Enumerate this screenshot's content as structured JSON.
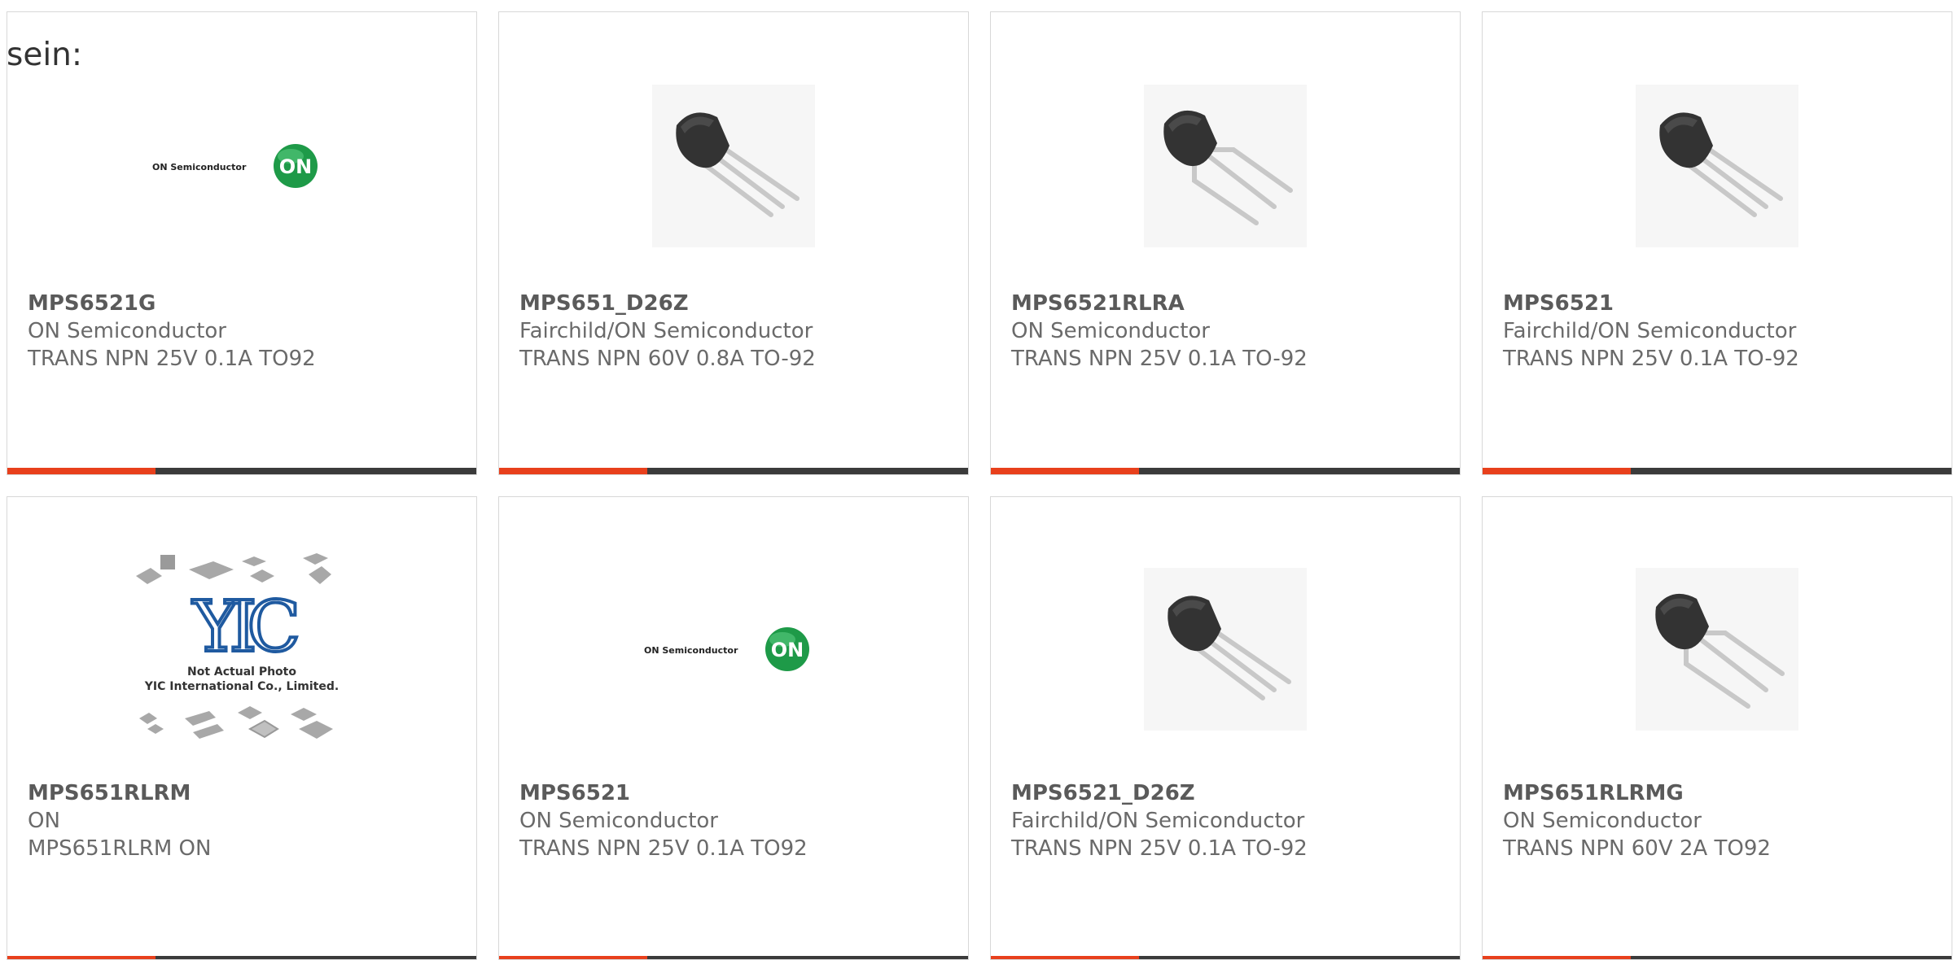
{
  "intro_text": "sein:",
  "colors": {
    "accent": "#e8401c",
    "bar": "#3b3b3b",
    "on_logo_green": "#1e9a48"
  },
  "products": [
    {
      "part": "MPS6521G",
      "maker": "ON Semiconductor",
      "desc": "TRANS NPN 25V 0.1A TO92",
      "image": "on-semiconductor-logo",
      "logo_text": "ON Semiconductor",
      "logo_badge": "ON"
    },
    {
      "part": "MPS651_D26Z",
      "maker": "Fairchild/ON Semiconductor",
      "desc": "TRANS NPN 60V 0.8A TO-92",
      "image": "to92-transistor-straight-leads"
    },
    {
      "part": "MPS6521RLRA",
      "maker": "ON Semiconductor",
      "desc": "TRANS NPN 25V 0.1A TO-92",
      "image": "to92-transistor-bent-leads"
    },
    {
      "part": "MPS6521",
      "maker": "Fairchild/ON Semiconductor",
      "desc": "TRANS NPN 25V 0.1A TO-92",
      "image": "to92-transistor-straight-leads"
    },
    {
      "part": "MPS651RLRM",
      "maker": "ON",
      "desc": "MPS651RLRM ON",
      "image": "yic-placeholder",
      "placeholder_line1": "Not Actual Photo",
      "placeholder_line2": "YIC International Co., Limited."
    },
    {
      "part": "MPS6521",
      "maker": "ON Semiconductor",
      "desc": "TRANS NPN 25V 0.1A TO92",
      "image": "on-semiconductor-logo",
      "logo_text": "ON Semiconductor",
      "logo_badge": "ON"
    },
    {
      "part": "MPS6521_D26Z",
      "maker": "Fairchild/ON Semiconductor",
      "desc": "TRANS NPN 25V 0.1A TO-92",
      "image": "to92-transistor-straight-leads"
    },
    {
      "part": "MPS651RLRMG",
      "maker": "ON Semiconductor",
      "desc": "TRANS NPN 60V 2A TO92",
      "image": "to92-transistor-bent-leads"
    }
  ]
}
